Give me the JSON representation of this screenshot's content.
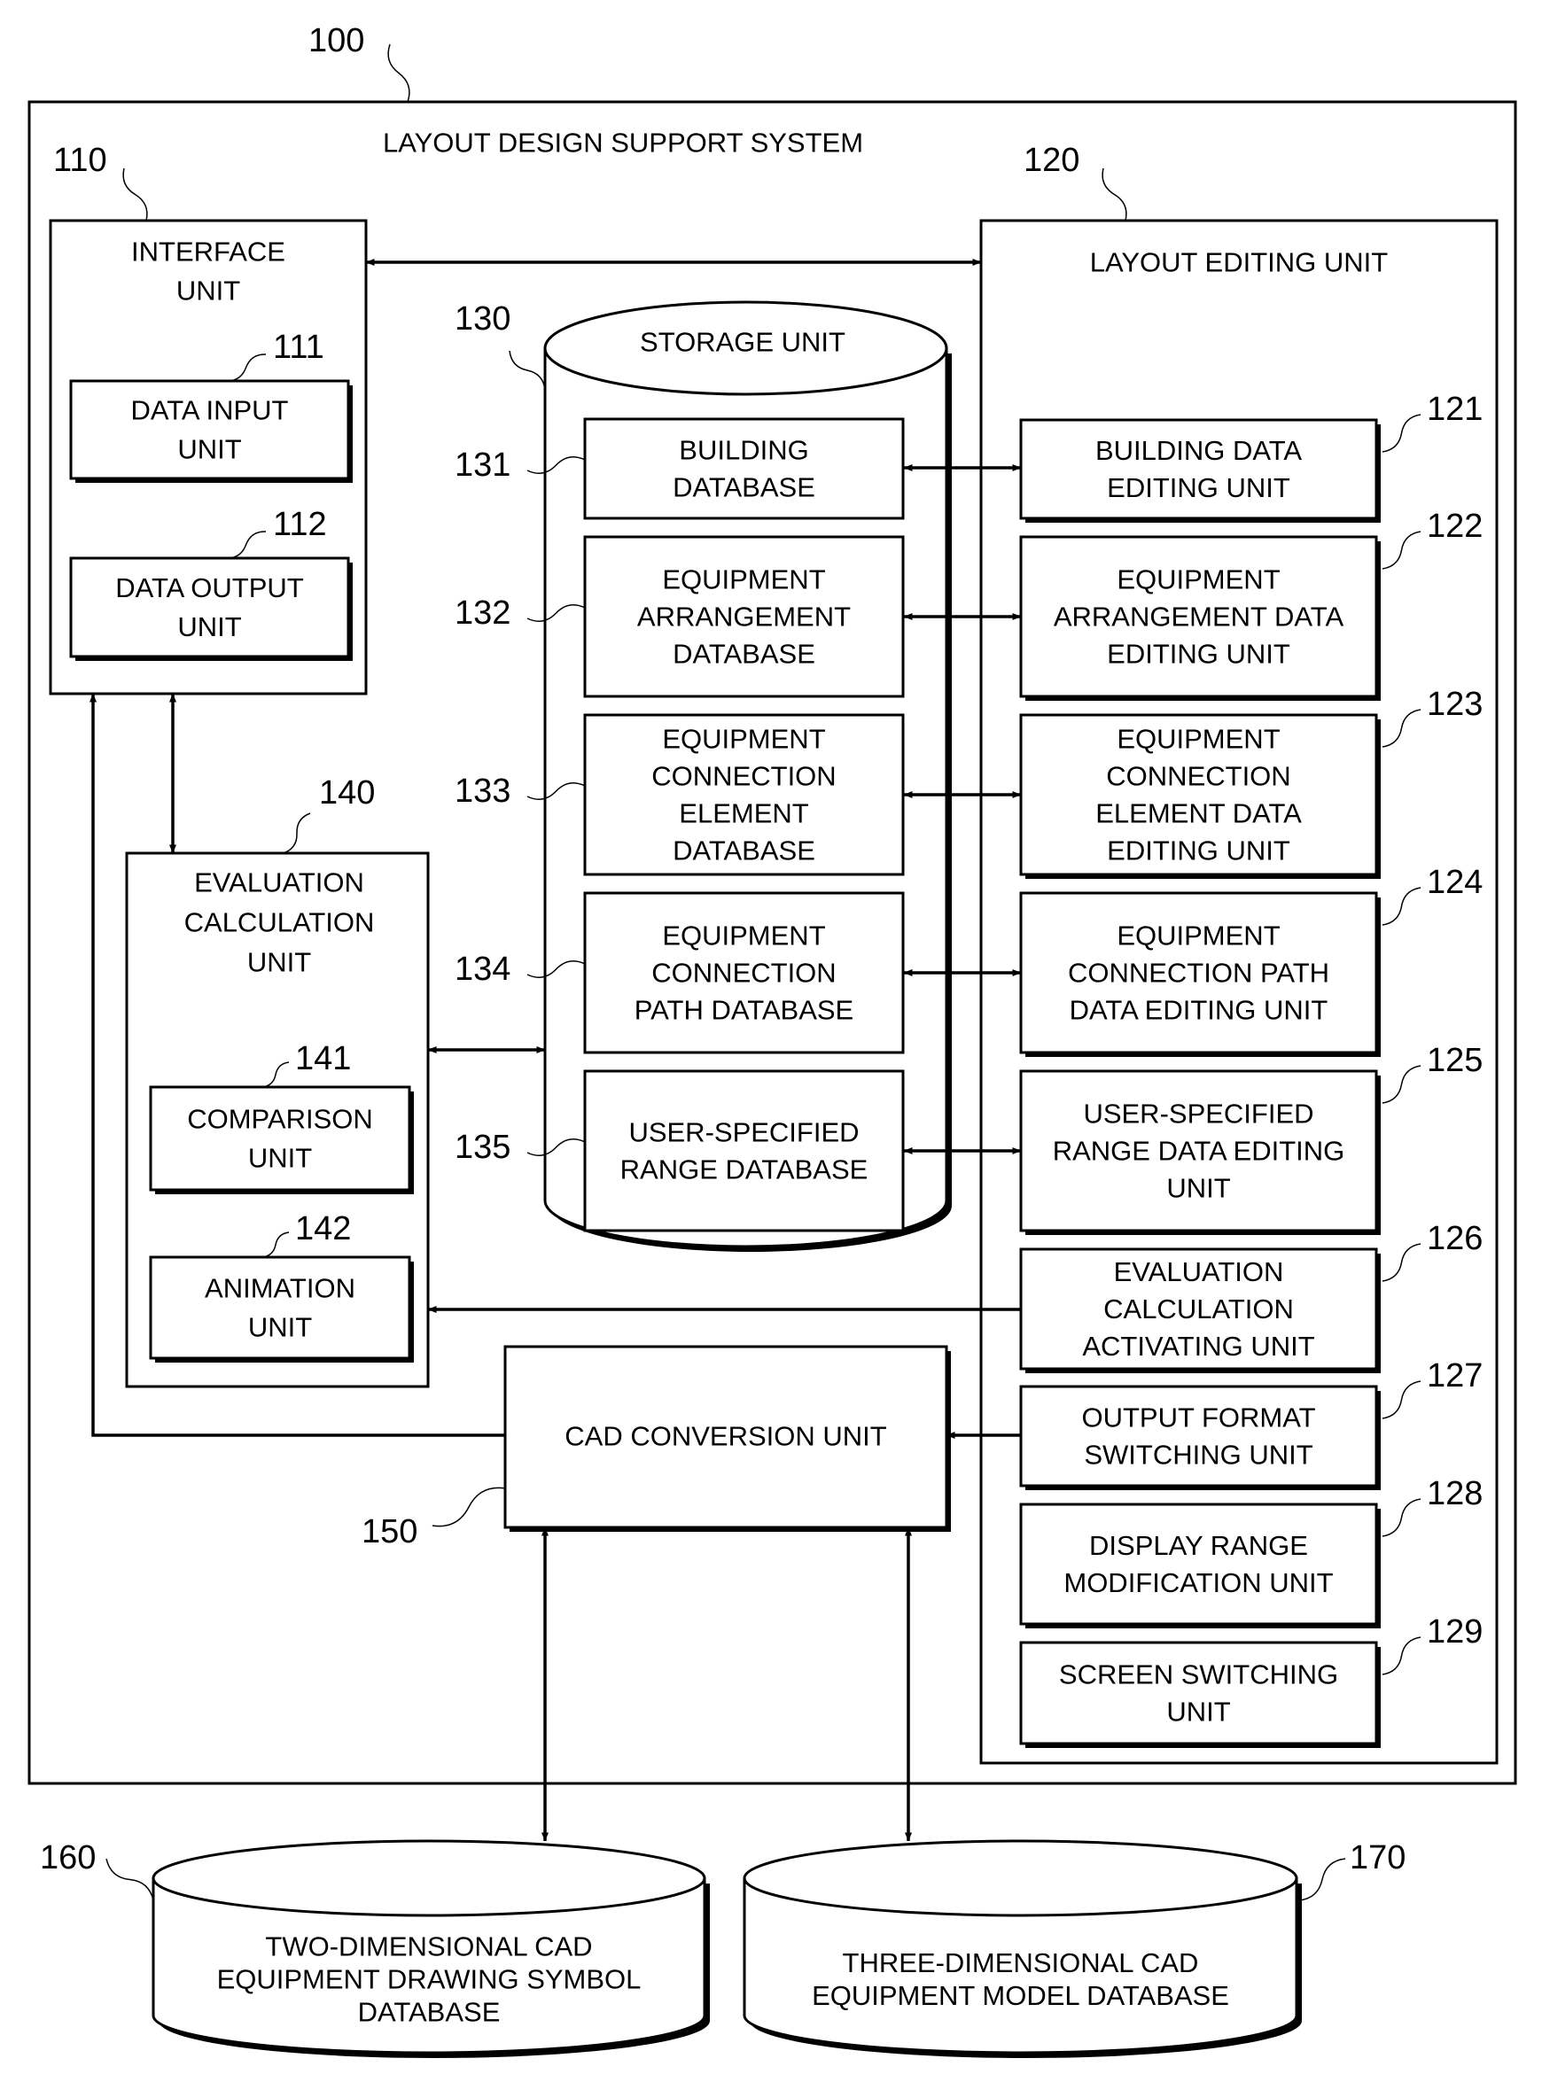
{
  "figure": {
    "system": {
      "ref": "100",
      "title": "LAYOUT DESIGN SUPPORT SYSTEM"
    },
    "interface_unit": {
      "ref": "110",
      "title": [
        "INTERFACE",
        "UNIT"
      ],
      "children": [
        {
          "ref": "111",
          "lines": [
            "DATA INPUT",
            "UNIT"
          ]
        },
        {
          "ref": "112",
          "lines": [
            "DATA OUTPUT",
            "UNIT"
          ]
        }
      ]
    },
    "layout_editing_unit": {
      "ref": "120",
      "title": [
        "LAYOUT EDITING UNIT"
      ],
      "children": [
        {
          "ref": "121",
          "lines": [
            "BUILDING DATA",
            "EDITING UNIT"
          ]
        },
        {
          "ref": "122",
          "lines": [
            "EQUIPMENT",
            "ARRANGEMENT DATA",
            "EDITING UNIT"
          ]
        },
        {
          "ref": "123",
          "lines": [
            "EQUIPMENT",
            "CONNECTION",
            "ELEMENT DATA",
            "EDITING UNIT"
          ]
        },
        {
          "ref": "124",
          "lines": [
            "EQUIPMENT",
            "CONNECTION PATH",
            "DATA EDITING UNIT"
          ]
        },
        {
          "ref": "125",
          "lines": [
            "USER-SPECIFIED",
            "RANGE DATA EDITING",
            "UNIT"
          ]
        },
        {
          "ref": "126",
          "lines": [
            "EVALUATION",
            "CALCULATION",
            "ACTIVATING UNIT"
          ]
        },
        {
          "ref": "127",
          "lines": [
            "OUTPUT FORMAT",
            "SWITCHING UNIT"
          ]
        },
        {
          "ref": "128",
          "lines": [
            "DISPLAY RANGE",
            "MODIFICATION UNIT"
          ]
        },
        {
          "ref": "129",
          "lines": [
            "SCREEN SWITCHING",
            "UNIT"
          ]
        }
      ]
    },
    "storage_unit": {
      "ref": "130",
      "title": [
        "STORAGE UNIT"
      ],
      "children": [
        {
          "ref": "131",
          "lines": [
            "BUILDING",
            "DATABASE"
          ]
        },
        {
          "ref": "132",
          "lines": [
            "EQUIPMENT",
            "ARRANGEMENT",
            "DATABASE"
          ]
        },
        {
          "ref": "133",
          "lines": [
            "EQUIPMENT",
            "CONNECTION",
            "ELEMENT",
            "DATABASE"
          ]
        },
        {
          "ref": "134",
          "lines": [
            "EQUIPMENT",
            "CONNECTION",
            "PATH DATABASE"
          ]
        },
        {
          "ref": "135",
          "lines": [
            "USER-SPECIFIED",
            "RANGE DATABASE"
          ]
        }
      ]
    },
    "evaluation_calculation_unit": {
      "ref": "140",
      "title": [
        "EVALUATION",
        "CALCULATION",
        "UNIT"
      ],
      "children": [
        {
          "ref": "141",
          "lines": [
            "COMPARISON",
            "UNIT"
          ]
        },
        {
          "ref": "142",
          "lines": [
            "ANIMATION",
            "UNIT"
          ]
        }
      ]
    },
    "cad_conversion_unit": {
      "ref": "150",
      "lines": [
        "CAD CONVERSION UNIT"
      ]
    },
    "databases": [
      {
        "ref": "160",
        "lines": [
          "TWO-DIMENSIONAL CAD",
          "EQUIPMENT DRAWING SYMBOL",
          "DATABASE"
        ]
      },
      {
        "ref": "170",
        "lines": [
          "THREE-DIMENSIONAL CAD",
          "EQUIPMENT MODEL DATABASE"
        ]
      }
    ],
    "connections": [
      {
        "from": "110",
        "to": "120",
        "direction": "bidirectional"
      },
      {
        "from": "110",
        "to": "140",
        "direction": "bidirectional"
      },
      {
        "from": "150",
        "to": "110",
        "direction": "one-way"
      },
      {
        "from": "140",
        "to": "130",
        "direction": "bidirectional"
      },
      {
        "from": "131",
        "to": "121",
        "direction": "bidirectional"
      },
      {
        "from": "132",
        "to": "122",
        "direction": "bidirectional"
      },
      {
        "from": "133",
        "to": "123",
        "direction": "bidirectional"
      },
      {
        "from": "134",
        "to": "124",
        "direction": "bidirectional"
      },
      {
        "from": "135",
        "to": "125",
        "direction": "bidirectional"
      },
      {
        "from": "126",
        "to": "140",
        "direction": "one-way"
      },
      {
        "from": "127",
        "to": "150",
        "direction": "one-way"
      },
      {
        "from": "150",
        "to": "160",
        "direction": "bidirectional"
      },
      {
        "from": "150",
        "to": "170",
        "direction": "bidirectional"
      }
    ]
  }
}
